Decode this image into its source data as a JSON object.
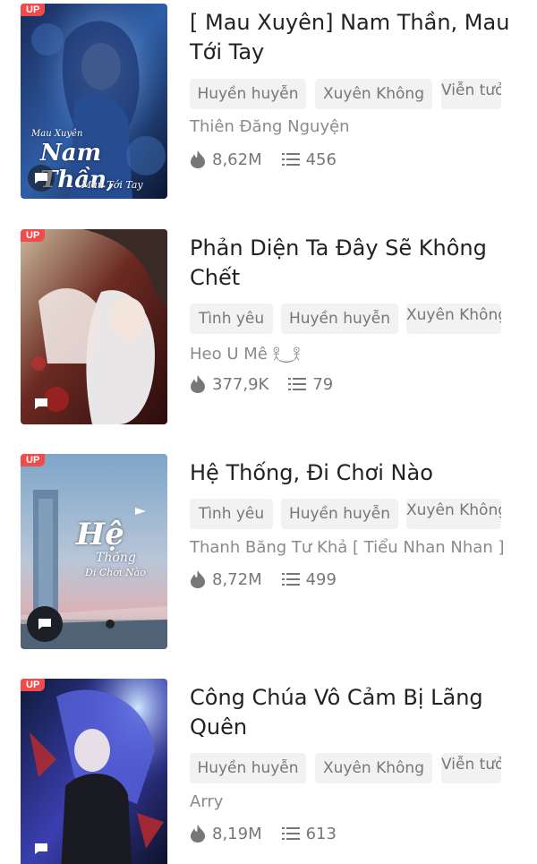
{
  "items": [
    {
      "badge": "UP",
      "title": "[ Mau Xuyên] Nam Thần, Mau Tới Tay",
      "tags": [
        "Huyền huyễn",
        "Xuyên Không",
        "Viễn tưởng"
      ],
      "author": "Thiên Đăng Nguyện",
      "views": "8,62M",
      "chapters": "456",
      "cover_text": "Nam Thần,",
      "cover_sub": "Mau Tới Tay",
      "cover_top": "Mau Xuyên"
    },
    {
      "badge": "UP",
      "title": "Phản Diện Ta Đây Sẽ Không Chết",
      "tags": [
        "Tình yêu",
        "Huyền huyễn",
        "Xuyên Không"
      ],
      "author": "Heo U Mê 𖨆‿𖨆",
      "views": "377,9K",
      "chapters": "79"
    },
    {
      "badge": "UP",
      "title": "Hệ Thống, Đi Chơi Nào",
      "tags": [
        "Tình yêu",
        "Huyền huyễn",
        "Xuyên Không"
      ],
      "author": "Thanh Băng Tư Khả [ Tiểu Nhan Nhan ]",
      "views": "8,72M",
      "chapters": "499",
      "cover_text": "Hệ",
      "cover_sub": "Thống",
      "cover_sub2": "Đi Chơi Nào"
    },
    {
      "badge": "UP",
      "title": "Công Chúa Vô Cảm Bị Lãng Quên",
      "tags": [
        "Huyền huyễn",
        "Xuyên Không",
        "Viễn tưởng"
      ],
      "author": "Arry",
      "views": "8,19M",
      "chapters": "613"
    }
  ],
  "icons": {
    "views": "fire-icon",
    "chapters": "list-icon",
    "comment": "chat-bubble-icon"
  },
  "colors": {
    "badge": "#f04c4c",
    "tag_bg": "#f2f2f2",
    "meta_text": "#8a8a8a"
  }
}
